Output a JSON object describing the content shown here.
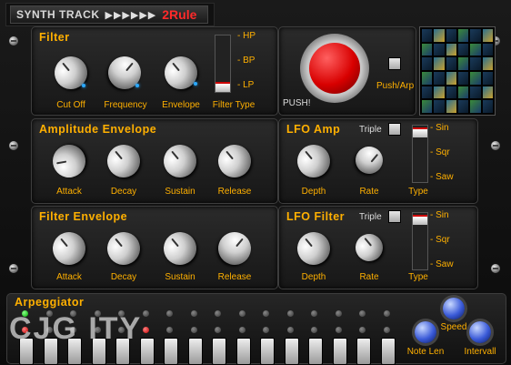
{
  "header": {
    "app_name": "SYNTH TRACK",
    "arrows": "▶▶▶▶▶▶",
    "brand": "2Rule"
  },
  "filter": {
    "title": "Filter",
    "knobs": [
      {
        "label": "Cut Off"
      },
      {
        "label": "Frequency"
      },
      {
        "label": "Envelope"
      }
    ],
    "type_label": "Filter Type",
    "type_options": [
      "- HP",
      "- BP",
      "- LP"
    ],
    "selected_type": "LP"
  },
  "push": {
    "button_label": "PUSH!",
    "arp_label": "Push/Arp"
  },
  "amp_env": {
    "title": "Amplitude Envelope",
    "knobs": [
      "Attack",
      "Decay",
      "Sustain",
      "Release"
    ]
  },
  "filter_env": {
    "title": "Filter Envelope",
    "knobs": [
      "Attack",
      "Decay",
      "Sustain",
      "Release"
    ]
  },
  "lfo_amp": {
    "title": "LFO Amp",
    "triple": "Triple",
    "depth": "Depth",
    "rate": "Rate",
    "type": "Type",
    "waves": [
      "- Sin",
      "- Sqr",
      "- Saw"
    ],
    "selected_wave": "Sin"
  },
  "lfo_filter": {
    "title": "LFO Filter",
    "triple": "Triple",
    "depth": "Depth",
    "rate": "Rate",
    "type": "Type",
    "waves": [
      "- Sin",
      "- Sqr",
      "- Saw"
    ],
    "selected_wave": "Sin"
  },
  "arp": {
    "title": "Arpeggiator",
    "note_len": "Note Len",
    "speed": "Speed",
    "interval": "Intervall",
    "steps": 16,
    "watermark": "CJG ITY"
  },
  "colors": {
    "label": "#ffb000",
    "brand": "#ff2a2a",
    "push": "#d80000",
    "arp_knob": "#3a5ad8"
  }
}
